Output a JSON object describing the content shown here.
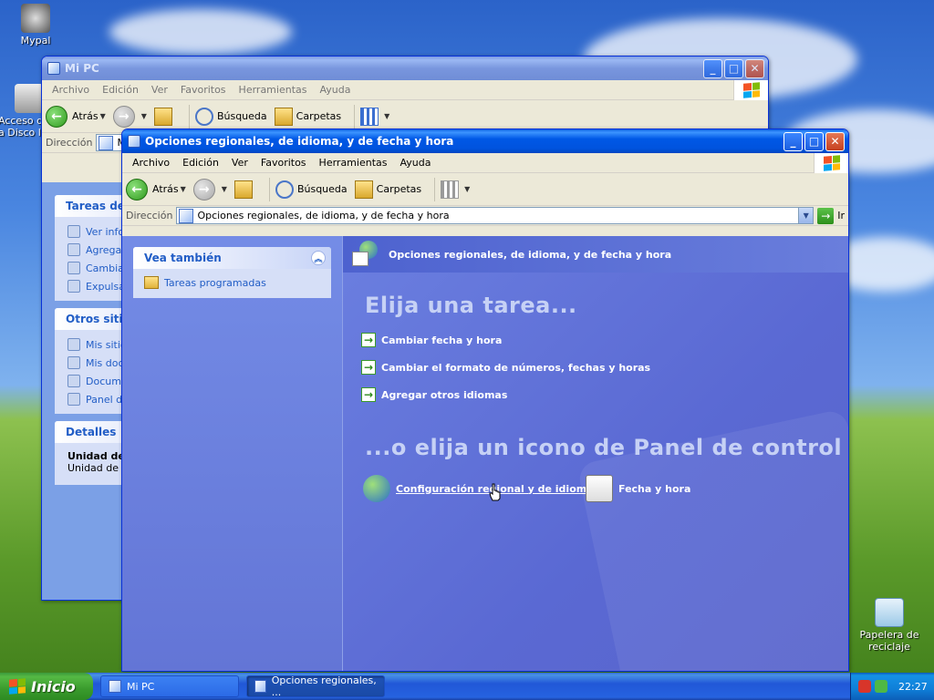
{
  "desktop": {
    "icons": [
      {
        "label": "Mypal"
      },
      {
        "label": "Acceso d"
      },
      {
        "label": "a Disco l"
      }
    ],
    "recycle_bin": {
      "line1": "Papelera de",
      "line2": "reciclaje"
    }
  },
  "mipc": {
    "title": "Mi PC",
    "menu": [
      "Archivo",
      "Edición",
      "Ver",
      "Favoritos",
      "Herramientas",
      "Ayuda"
    ],
    "toolbar": {
      "back": "Atrás",
      "search": "Búsqueda",
      "folders": "Carpetas"
    },
    "address_label": "Dirección",
    "address_value": "M",
    "panels": [
      {
        "title": "Tareas del",
        "items": [
          "Ver info",
          "Agrega",
          "Cambia",
          "Expulsa"
        ]
      },
      {
        "title": "Otros sitio",
        "items": [
          "Mis sitio",
          "Mis doc",
          "Docume",
          "Panel d"
        ]
      },
      {
        "title": "Detalles",
        "items": [
          "Unidad de",
          "Unidad de C"
        ]
      }
    ]
  },
  "regional": {
    "title": "Opciones regionales, de idioma, y de fecha y hora",
    "menu": [
      "Archivo",
      "Edición",
      "Ver",
      "Favoritos",
      "Herramientas",
      "Ayuda"
    ],
    "toolbar": {
      "back": "Atrás",
      "search": "Búsqueda",
      "folders": "Carpetas"
    },
    "address_label": "Dirección",
    "address_value": "Opciones regionales, de idioma, y de fecha y hora",
    "go_label": "Ir",
    "see_also": {
      "title": "Vea también",
      "items": [
        "Tareas programadas"
      ]
    },
    "header": "Opciones regionales, de idioma, y de fecha y hora",
    "pick_task": "Elija una tarea...",
    "tasks": [
      "Cambiar fecha y hora",
      "Cambiar el formato de números, fechas y horas",
      "Agregar otros idiomas"
    ],
    "or_pick": "...o elija un icono de Panel de control",
    "cp_icons": [
      "Configuración regional y de idioma",
      "Fecha y hora"
    ]
  },
  "taskbar": {
    "start": "Inicio",
    "buttons": [
      "Mi PC",
      "Opciones regionales, ..."
    ],
    "clock": "22:27"
  },
  "colors": {
    "title_active": "#0058e6",
    "taskpane_bg": "#6b7fe0",
    "start_green": "#3a9b2d"
  }
}
